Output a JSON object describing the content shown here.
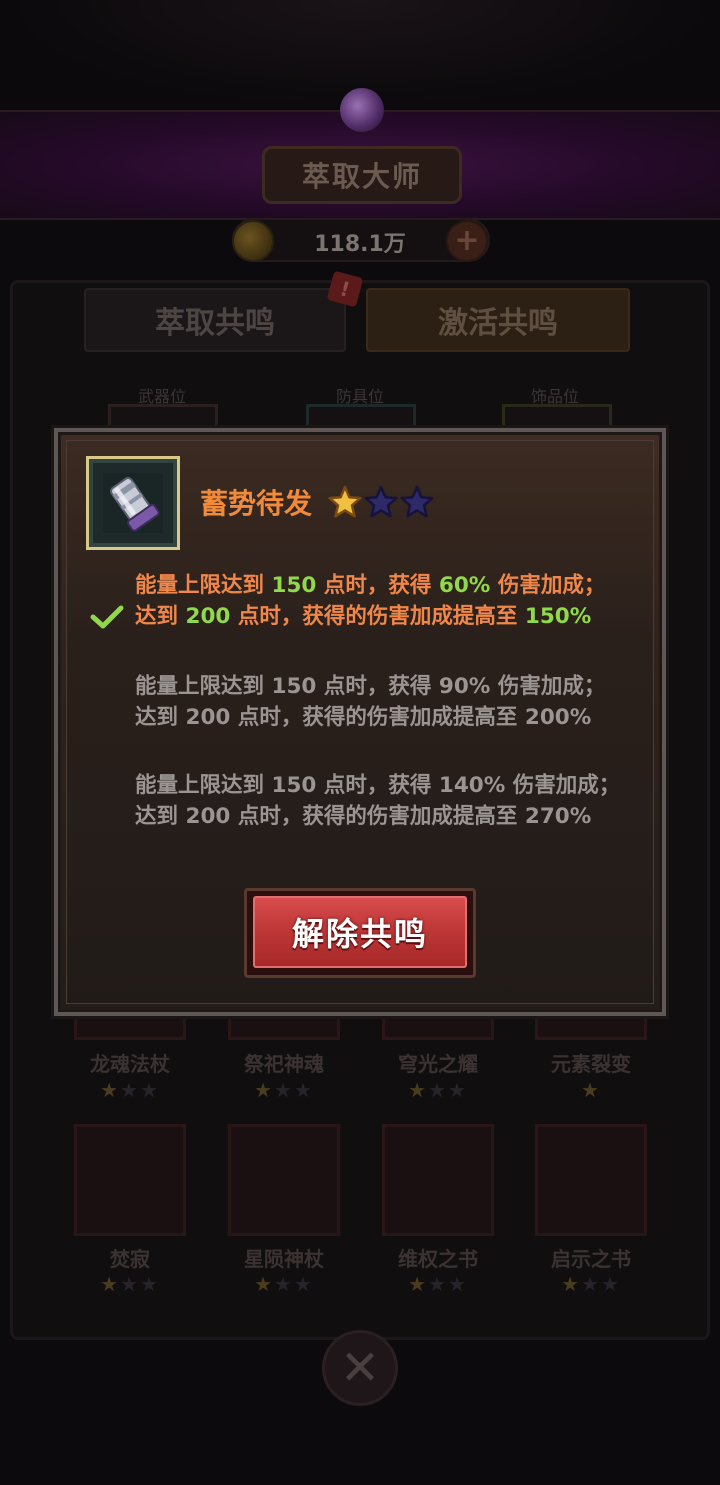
{
  "header": {
    "title": "萃取大师",
    "currency_value": "118.1万"
  },
  "tabs": [
    {
      "label": "萃取共鸣"
    },
    {
      "label": "激活共鸣"
    }
  ],
  "tab_badge": "!",
  "slots": [
    {
      "label": "武器位"
    },
    {
      "label": "防具位"
    },
    {
      "label": "饰品位"
    }
  ],
  "grid_items": [
    {
      "name": "龙魂法杖",
      "stars": 1
    },
    {
      "name": "祭祀神魂",
      "stars": 1
    },
    {
      "name": "穹光之耀",
      "stars": 1
    },
    {
      "name": "元素裂变",
      "stars": 1
    },
    {
      "name": "焚寂",
      "stars": 1
    },
    {
      "name": "星陨神杖",
      "stars": 1
    },
    {
      "name": "维权之书",
      "stars": 1
    },
    {
      "name": "启示之书",
      "stars": 1
    }
  ],
  "modal": {
    "skill_name": "蓄势待发",
    "star_level": 1,
    "star_max": 3,
    "tiers": [
      {
        "active": true,
        "parts": [
          "能量上限达到 ",
          "150",
          " 点时，获得 ",
          "60%",
          " 伤害加成；达到 ",
          "200",
          " 点时，获得的伤害加成提高至 ",
          "150%"
        ]
      },
      {
        "active": false,
        "parts": [
          "能量上限达到 ",
          "150",
          " 点时，获得 ",
          "90%",
          " 伤害加成；达到 ",
          "200",
          " 点时，获得的伤害加成提高至 ",
          "200%"
        ]
      },
      {
        "active": false,
        "parts": [
          "能量上限达到 ",
          "150",
          " 点时，获得 ",
          "140%",
          " 伤害加成；达到 ",
          "200",
          " 点时，获得的伤害加成提高至 ",
          "270%"
        ]
      }
    ],
    "dissolve_label": "解除共鸣"
  },
  "colors": {
    "skill_title": "#f28a3a",
    "active_text": "#f0874a",
    "active_number": "#8fd94a",
    "inactive_text": "#9a9492",
    "button": "#c03838"
  },
  "icons": {
    "item": "gauntlet-icon",
    "check": "check-icon",
    "close": "close-x-icon",
    "coin": "coin-icon",
    "plus": "plus-icon",
    "star": "star-icon"
  }
}
